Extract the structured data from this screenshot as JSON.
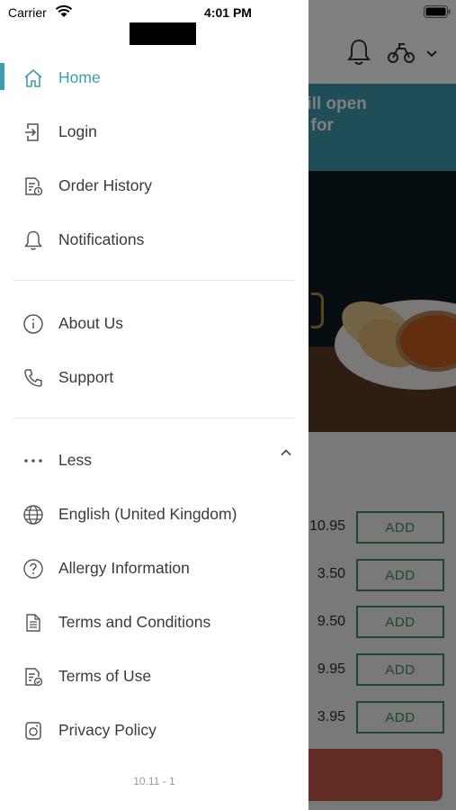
{
  "status_bar": {
    "carrier": "Carrier",
    "time": "4:01 PM"
  },
  "drawer": {
    "items_top": [
      {
        "label": "Home",
        "icon": "home-icon",
        "active": true
      },
      {
        "label": "Login",
        "icon": "login-icon"
      },
      {
        "label": "Order History",
        "icon": "order-history-icon"
      },
      {
        "label": "Notifications",
        "icon": "bell-icon"
      }
    ],
    "items_mid": [
      {
        "label": "About Us",
        "icon": "info-icon"
      },
      {
        "label": "Support",
        "icon": "phone-icon"
      }
    ],
    "less_label": "Less",
    "items_bottom": [
      {
        "label": "English (United Kingdom)",
        "icon": "globe-icon"
      },
      {
        "label": "Allergy Information",
        "icon": "question-icon"
      },
      {
        "label": "Terms and Conditions",
        "icon": "document-icon"
      },
      {
        "label": "Terms of Use",
        "icon": "document-check-icon"
      },
      {
        "label": "Privacy Policy",
        "icon": "privacy-icon"
      }
    ],
    "version": "10.11 - 1"
  },
  "background": {
    "banner_text": "ed and will open\nrder now for",
    "prices": [
      "10.95",
      "3.50",
      "9.50",
      "9.95",
      "3.95"
    ],
    "add_label": "ADD"
  },
  "colors": {
    "accent": "#3e9bb0",
    "add_green": "#3e8e57",
    "checkout": "#c25b46"
  }
}
